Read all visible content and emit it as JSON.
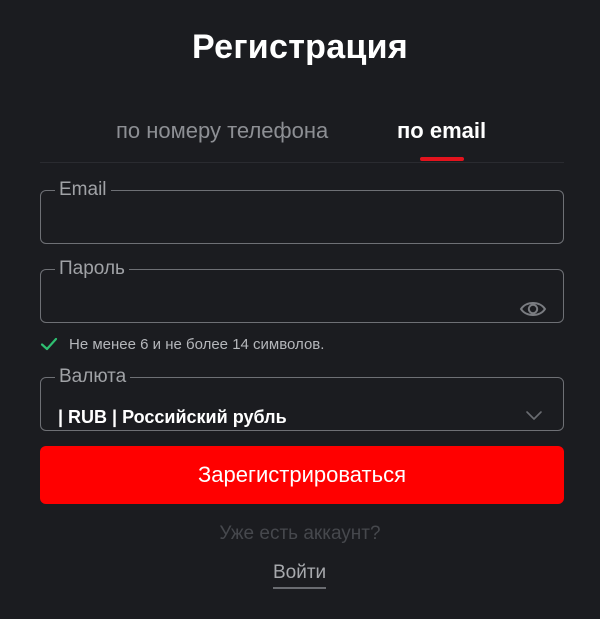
{
  "title": "Регистрация",
  "tabs": {
    "phone_label": "по номеру телефона",
    "email_label": "по email",
    "active": "email"
  },
  "fields": {
    "email": {
      "label": "Email",
      "value": ""
    },
    "password": {
      "label": "Пароль",
      "value": "",
      "toggle_icon": "eye-icon"
    },
    "currency": {
      "label": "Валюта",
      "selected": "| RUB | Российский рубль",
      "dropdown_icon": "chevron-down-icon"
    }
  },
  "hint": {
    "text": "Не менее 6 и не более 14 символов.",
    "icon": "check-icon"
  },
  "submit_label": "Зарегистрироваться",
  "login_prompt": "Уже есть аккаунт?",
  "login_link": "Войти",
  "colors": {
    "background": "#1b1c20",
    "accent": "#ff0000",
    "tab_underline": "#e3131d",
    "check": "#2fbf71"
  }
}
